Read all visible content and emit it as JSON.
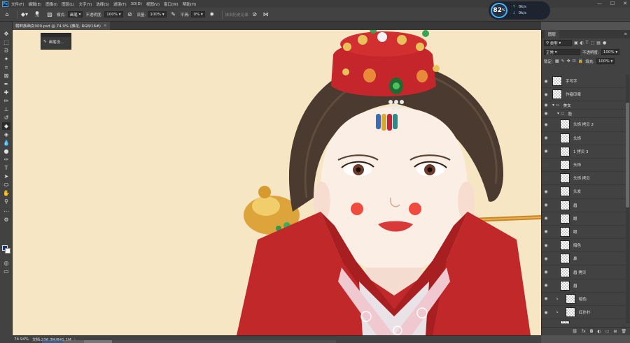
{
  "menu": {
    "logo": "Ps",
    "items": [
      "文件(F)",
      "编辑(E)",
      "图像(I)",
      "图层(L)",
      "文字(Y)",
      "选择(S)",
      "滤镜(T)",
      "3D(D)",
      "视图(V)",
      "窗口(W)",
      "帮助(H)"
    ]
  },
  "options": {
    "brush_size": "70",
    "mode_label": "模式:",
    "mode_value": "画笔",
    "opacity_label": "不透明度:",
    "opacity_value": "100%",
    "flow_label": "流量:",
    "flow_value": "100%",
    "smooth_label": "平滑:",
    "smooth_value": "0%",
    "erase_history": "抹到历史记录"
  },
  "document": {
    "tab_title": "朝鲜族画女009.psd @ 74.9% (拂花, RGB/16#)",
    "close": "×"
  },
  "perf": {
    "percent": "82",
    "unit": "%",
    "up": "0k/s",
    "down": "0k/s"
  },
  "mini_panel": {
    "label": "画笔设..."
  },
  "layers_panel": {
    "tab": "图层",
    "filter_label": "类型",
    "blend_mode": "正常",
    "opacity_label": "不透明度:",
    "opacity_value": "100%",
    "lock_label": "锁定:",
    "fill_label": "填充:",
    "fill_value": "100%",
    "layers": [
      {
        "name": "手写字",
        "kind": "layer",
        "visible": true
      },
      {
        "name": "作者印章",
        "kind": "layer",
        "visible": true
      },
      {
        "name": "美女",
        "kind": "folder",
        "visible": true
      },
      {
        "name": "脸",
        "kind": "folder",
        "visible": true
      },
      {
        "name": "头饰 拷贝 2",
        "kind": "layer",
        "visible": true
      },
      {
        "name": "头饰",
        "kind": "layer",
        "visible": true
      },
      {
        "name": "1 拷贝 3",
        "kind": "layer",
        "visible": true
      },
      {
        "name": "头饰",
        "kind": "layer",
        "visible": false
      },
      {
        "name": "头饰 拷贝",
        "kind": "layer",
        "visible": false
      },
      {
        "name": "头发",
        "kind": "layer",
        "visible": true
      },
      {
        "name": "眉",
        "kind": "layer",
        "visible": true
      },
      {
        "name": "眼",
        "kind": "layer",
        "visible": true
      },
      {
        "name": "眼",
        "kind": "layer",
        "visible": true
      },
      {
        "name": "暗色",
        "kind": "layer",
        "visible": true
      },
      {
        "name": "鼻",
        "kind": "layer",
        "visible": true
      },
      {
        "name": "眉 拷贝",
        "kind": "layer",
        "visible": true
      },
      {
        "name": "眉",
        "kind": "layer",
        "visible": true
      },
      {
        "name": "暗色",
        "kind": "layer",
        "visible": true,
        "clipped": true
      },
      {
        "name": "红扑扑",
        "kind": "layer",
        "visible": true,
        "clipped": true
      },
      {
        "name": "脸",
        "kind": "layer",
        "visible": true
      }
    ]
  },
  "status": {
    "zoom": "74.94%",
    "doc_info": "文档:236.3M/841.1M"
  }
}
